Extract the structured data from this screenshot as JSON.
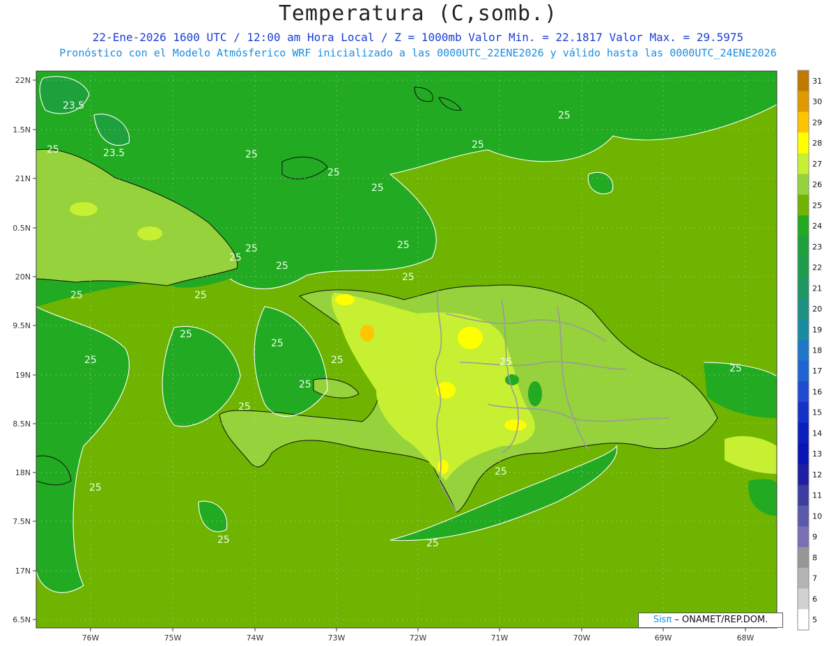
{
  "header": {
    "title": "Temperatura (C,somb.)",
    "subtitle_1": "22-Ene-2026 1600 UTC / 12:00 am Hora Local / Z = 1000mb  Valor Min. = 22.1817  Valor Max. = 29.5975",
    "subtitle_2": "Pronóstico con el Modelo Atmósferico WRF inicializado a las 0000UTC_22ENE2026 y válido hasta las  0000UTC_24ENE2026"
  },
  "axes": {
    "lat_labels": [
      "22N",
      "1.5N",
      "21N",
      "0.5N",
      "20N",
      "9.5N",
      "19N",
      "8.5N",
      "18N",
      "7.5N",
      "17N",
      "6.5N"
    ],
    "lon_labels": [
      "76W",
      "75W",
      "74W",
      "73W",
      "72W",
      "71W",
      "70W",
      "69W",
      "68W"
    ]
  },
  "contour_labels": [
    "23.5",
    "23.5",
    "25",
    "25",
    "25",
    "25",
    "25",
    "25",
    "25",
    "25",
    "25",
    "25",
    "25",
    "25",
    "25",
    "25",
    "25",
    "25",
    "25",
    "25",
    "25",
    "25",
    "25",
    "25",
    "25"
  ],
  "legend": {
    "levels": [
      "31",
      "30",
      "29",
      "28",
      "27",
      "26",
      "25",
      "24",
      "23",
      "22",
      "21",
      "20",
      "19",
      "18",
      "17",
      "16",
      "15",
      "14",
      "13",
      "12",
      "11",
      "10",
      "9",
      "8",
      "7",
      "6",
      "5"
    ],
    "colors": [
      "#c07a00",
      "#e09a00",
      "#ffc400",
      "#ffff00",
      "#c8f032",
      "#96d23c",
      "#6eb400",
      "#22aa22",
      "#1ea03c",
      "#1e9b4b",
      "#1e9664",
      "#1e9182",
      "#1a8ca0",
      "#1e78c8",
      "#1e64d2",
      "#1e4bd2",
      "#1432c8",
      "#0a1ebe",
      "#0a14b4",
      "#1e1ea0",
      "#3c3ca0",
      "#5a5aaa",
      "#7c6eb4",
      "#969696",
      "#b4b4b4",
      "#d2d2d2",
      "#ffffff"
    ]
  },
  "credit": {
    "sis": "Sisπ",
    "org": " – ONAMET/REP.DOM."
  }
}
